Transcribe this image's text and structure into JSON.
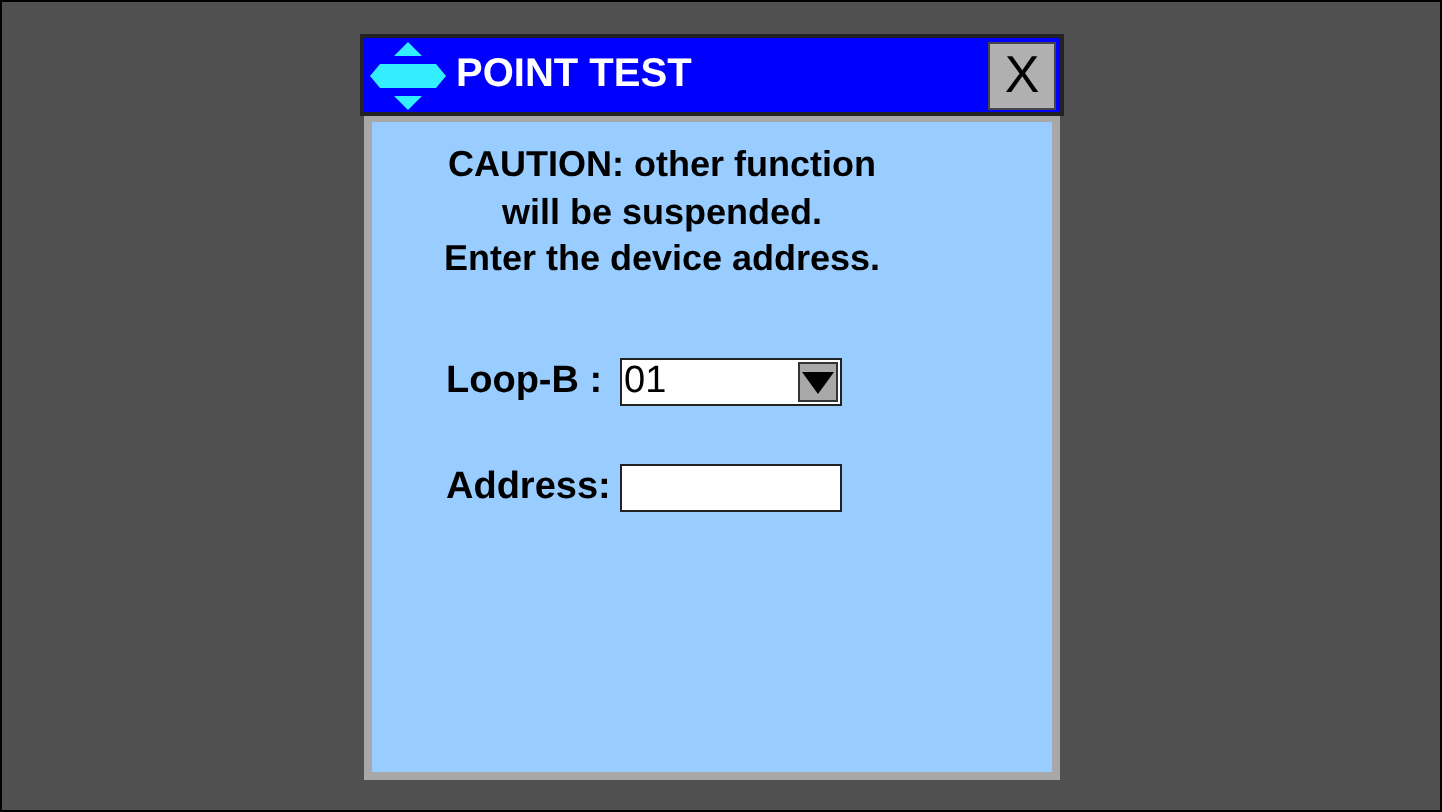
{
  "window": {
    "title": "POINT TEST",
    "close": "X"
  },
  "message": [
    "CAUTION: other function",
    "will be suspended.",
    "Enter the device address."
  ],
  "fields": [
    {
      "kind": "dropdown",
      "label": "Loop-B :",
      "value": "01"
    },
    {
      "kind": "text",
      "label": "Address:"
    }
  ]
}
